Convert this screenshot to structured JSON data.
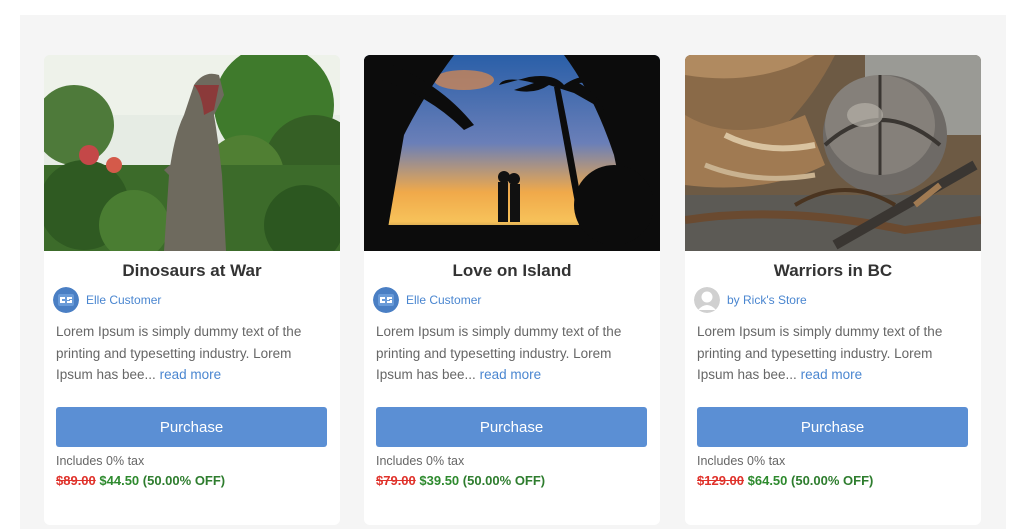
{
  "products": [
    {
      "title": "Dinosaurs at War",
      "author": "Elle Customer",
      "avatar_icon": "logo-avatar-icon",
      "description": "Lorem Ipsum is simply dummy text of the printing and typesetting industry. Lorem Ipsum has bee...",
      "read_more": "read more",
      "button": "Purchase",
      "tax": "Includes 0% tax",
      "old_price": "$89.00",
      "new_price": "$44.50",
      "discount": "(50.00% OFF)"
    },
    {
      "title": "Love on Island",
      "author": "Elle Customer",
      "avatar_icon": "logo-avatar-icon",
      "description": "Lorem Ipsum is simply dummy text of the printing and typesetting industry. Lorem Ipsum has bee...",
      "read_more": "read more",
      "button": "Purchase",
      "tax": "Includes 0% tax",
      "old_price": "$79.00",
      "new_price": "$39.50",
      "discount": "(50.00% OFF)"
    },
    {
      "title": "Warriors in BC",
      "author": "by Rick's Store",
      "avatar_icon": "default-user-icon",
      "description": "Lorem Ipsum is simply dummy text of the printing and typesetting industry. Lorem Ipsum has bee...",
      "read_more": "read more",
      "button": "Purchase",
      "tax": "Includes 0% tax",
      "old_price": "$129.00",
      "new_price": "$64.50",
      "discount": "(50.00% OFF)"
    }
  ],
  "colors": {
    "accent": "#5b8fd4",
    "link": "#4a86d0",
    "old_price": "#e0322b",
    "new_price": "#2e8a2e"
  }
}
